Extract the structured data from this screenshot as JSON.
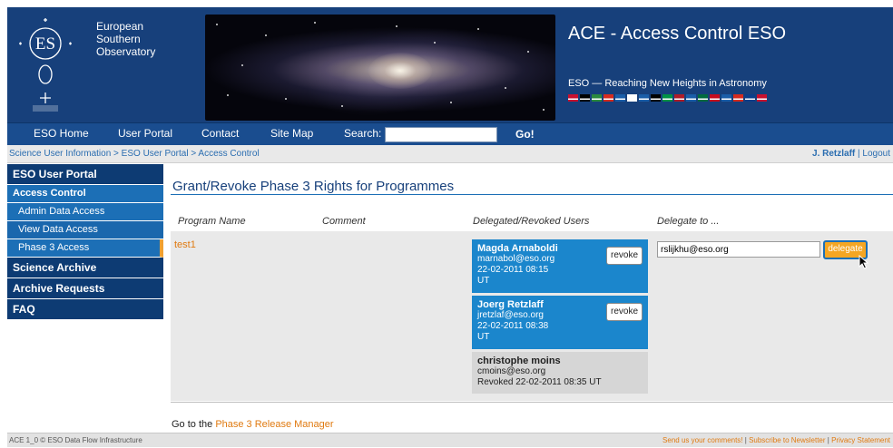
{
  "header": {
    "org_line1": "European",
    "org_line2": "Southern",
    "org_line3": "Observatory",
    "logo_text": "ES",
    "title": "ACE - Access Control ESO",
    "tagline": "ESO — Reaching New Heights in Astronomy",
    "flag_colors": [
      "#c8102e",
      "#000000",
      "#2b8a3e",
      "#d52b1e",
      "#1a5ea8",
      "#ffffff",
      "#1a5ea8",
      "#000000",
      "#009246",
      "#ae1c28",
      "#1a5ea8",
      "#006b3f",
      "#c60b1e",
      "#1a5ea8",
      "#d52b1e",
      "#0b3f8a",
      "#c8102e"
    ]
  },
  "nav": {
    "items": [
      "ESO Home",
      "User Portal",
      "Contact",
      "Site Map"
    ],
    "search_label": "Search:",
    "search_value": "",
    "go_label": "Go!"
  },
  "breadcrumb": "Science User Information > ESO User Portal > Access Control",
  "user": {
    "name": "J. Retzlaff",
    "separator": " | ",
    "logout": "Logout"
  },
  "sidebar": {
    "portal": "ESO User Portal",
    "access_control": "Access Control",
    "sub_items": [
      "Admin Data Access",
      "View Data Access",
      "Phase 3 Access"
    ],
    "science_archive": "Science Archive",
    "archive_requests": "Archive Requests",
    "faq": "FAQ"
  },
  "main": {
    "page_title": "Grant/Revoke Phase 3 Rights for Programmes",
    "columns": [
      "Program Name",
      "Comment",
      "Delegated/Revoked Users",
      "Delegate to ..."
    ],
    "program_name": "test1",
    "users": [
      {
        "name": "Magda Arnaboldi",
        "email": "marnabol@eso.org",
        "date": "22-02-2011 08:15",
        "tz": "UT",
        "revoke_label": "revoke"
      },
      {
        "name": "Joerg Retzlaff",
        "email": "jretzlaf@eso.org",
        "date": "22-02-2011 08:38",
        "tz": "UT",
        "revoke_label": "revoke"
      },
      {
        "name": "christophe moins",
        "email": "cmoins@eso.org",
        "revoked": "Revoked 22-02-2011 08:35 UT"
      }
    ],
    "delegate_value": "rslijkhu@eso.org",
    "delegate_label": "delegate",
    "release_prefix": "Go to the ",
    "release_link": "Phase 3 Release Manager"
  },
  "footer": {
    "left": "ACE 1_0 © ESO Data Flow Infrastructure",
    "links": [
      "Send us your comments!",
      "Subscribe to Newsletter",
      "Privacy Statement"
    ],
    "separator": " | "
  }
}
